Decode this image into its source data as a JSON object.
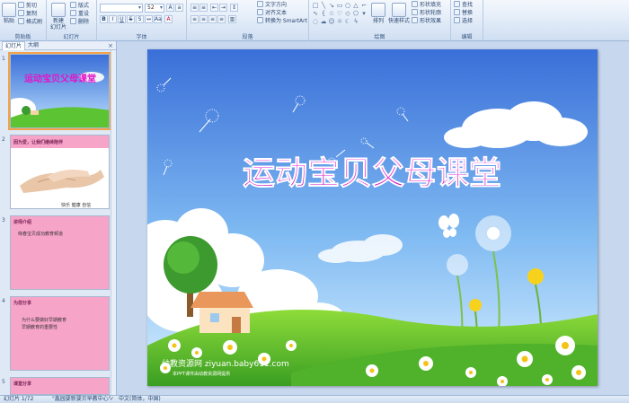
{
  "ribbon": {
    "clipboard": {
      "label": "剪贴板",
      "paste": "粘贴",
      "cut": "剪切",
      "copy": "复制",
      "format_painter": "格式刷"
    },
    "slides": {
      "label": "幻灯片",
      "new_slide": "新建",
      "new_slide2": "幻灯片",
      "layout": "版式",
      "reset": "重设",
      "delete": "删除"
    },
    "font": {
      "label": "字体",
      "font_name": "",
      "font_size": "52"
    },
    "paragraph": {
      "label": "段落",
      "text_direction": "文字方向",
      "align_text": "对齐文本",
      "smartart": "转换为 SmartArt"
    },
    "drawing": {
      "label": "绘图",
      "arrange": "排列",
      "quick_styles": "快速样式",
      "shape_fill": "形状填充",
      "shape_outline": "形状轮廓",
      "shape_effects": "形状效果"
    },
    "editing": {
      "label": "编辑",
      "find": "查找",
      "replace": "替换",
      "select": "选择"
    }
  },
  "left_panel": {
    "tab_slides": "幻灯片",
    "tab_outline": "大纲",
    "thumbnails": [
      {
        "num": "1",
        "title": "运动宝贝父母课堂"
      },
      {
        "num": "2",
        "title": "因为爱，让我们继续陪伴",
        "caption": "快乐  健康  自信"
      },
      {
        "num": "3",
        "title": "讲师介绍",
        "line1": "咏春宝贝成功教育频道"
      },
      {
        "num": "4",
        "title": "为您分享",
        "line1": "为什么要做好早期教育",
        "line2": "早期教育的重要性"
      },
      {
        "num": "5",
        "title": "课堂分享"
      }
    ]
  },
  "slide": {
    "title": "运动宝贝父母课堂",
    "watermark": "幼教资源网 ziyuan.baby611.com",
    "watermark_small": "本PPT课件由幼教资源网提供"
  },
  "status": {
    "slide_count": "幻灯片 1/72",
    "theme": "\"鑫园婴新婴贝早教中心\"",
    "language": "中文(简体，中国)"
  },
  "colors": {
    "title": "#e414c8",
    "sky_top": "#3a6fd8",
    "grass": "#5cc433",
    "thumb_pink": "#f7a4c9"
  }
}
